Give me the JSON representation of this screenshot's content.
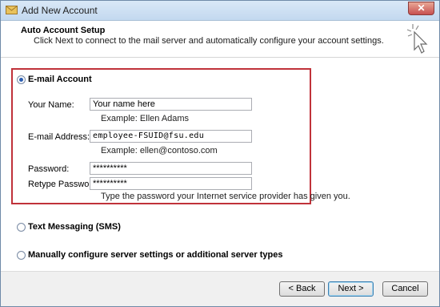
{
  "window": {
    "title": "Add New Account",
    "close_symbol": "✕"
  },
  "header": {
    "title": "Auto Account Setup",
    "subtitle": "Click Next to connect to the mail server and automatically configure your account settings."
  },
  "email_account": {
    "label": "E-mail Account",
    "selected": true,
    "your_name": {
      "label": "Your Name:",
      "value": "Your name here",
      "example": "Example: Ellen Adams"
    },
    "email_address": {
      "label": "E-mail Address:",
      "value": "employee-FSUID@fsu.edu",
      "example": "Example: ellen@contoso.com"
    },
    "password": {
      "label": "Password:",
      "value": "**********"
    },
    "retype_password": {
      "label": "Retype Password:",
      "value": "**********",
      "hint": "Type the password your Internet service provider has given you."
    }
  },
  "text_messaging": {
    "label": "Text Messaging (SMS)",
    "selected": false
  },
  "manual_config": {
    "label": "Manually configure server settings or additional server types",
    "selected": false
  },
  "buttons": {
    "back": "< Back",
    "next": "Next >",
    "cancel": "Cancel"
  },
  "colors": {
    "highlight_border": "#c0323a",
    "radio_dot": "#2c5fb3"
  }
}
